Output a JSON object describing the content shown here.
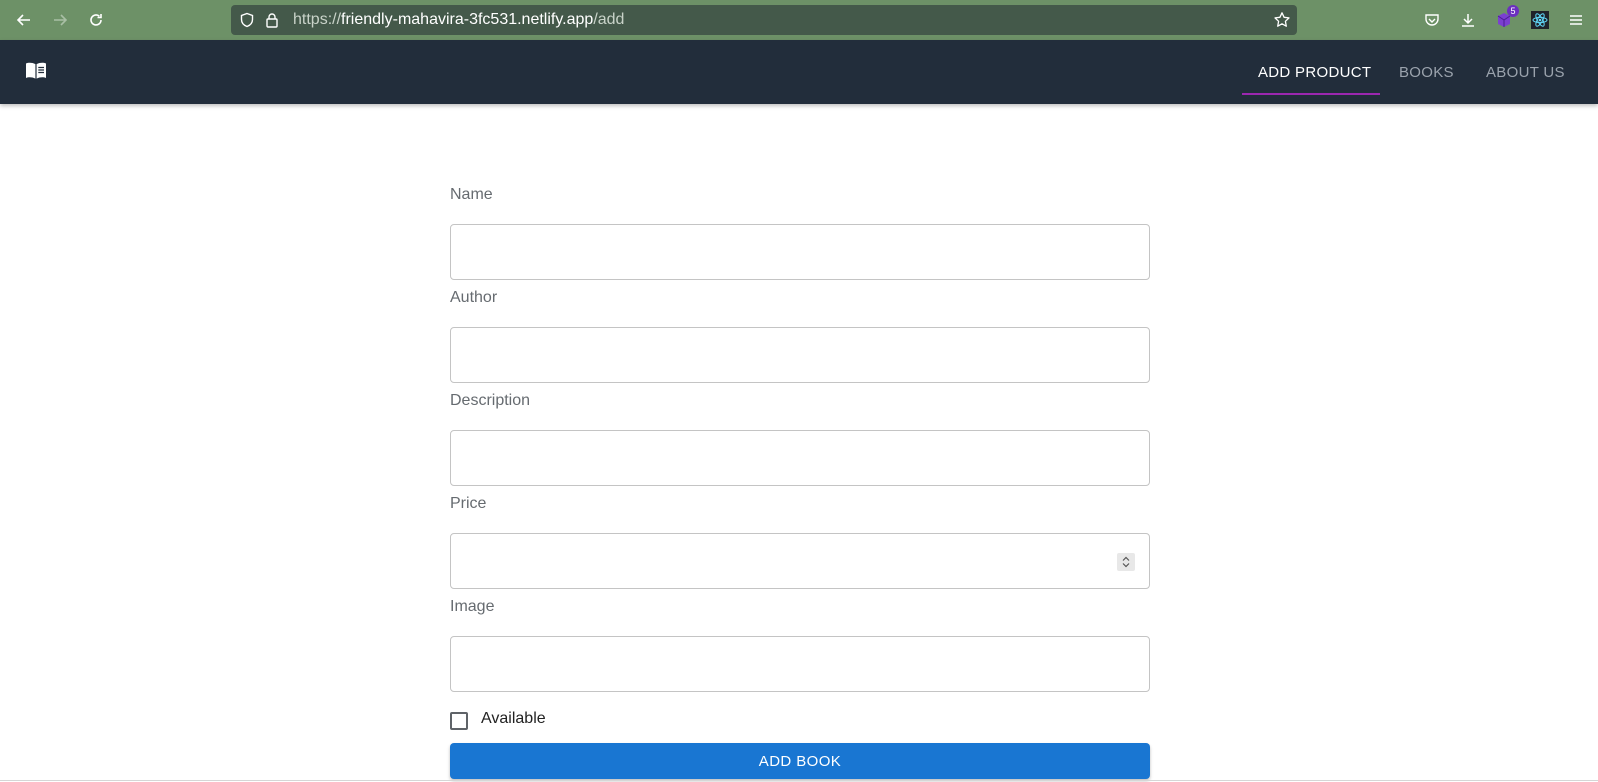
{
  "browser": {
    "url_prefix": "https://",
    "url_host": "friendly-mahavira-3fc531.netlify.app",
    "url_path": "/add",
    "extension_badge": "5"
  },
  "header": {
    "tabs": [
      {
        "label": "ADD PRODUCT",
        "active": true
      },
      {
        "label": "BOOKS",
        "active": false
      },
      {
        "label": "ABOUT US",
        "active": false
      }
    ],
    "accent_color": "#9c27b0",
    "background_color": "#222d3b"
  },
  "form": {
    "fields": [
      {
        "label": "Name",
        "value": ""
      },
      {
        "label": "Author",
        "value": ""
      },
      {
        "label": "Description",
        "value": ""
      },
      {
        "label": "Price",
        "value": ""
      },
      {
        "label": "Image",
        "value": ""
      }
    ],
    "checkbox_label": "Available",
    "checkbox_checked": false,
    "submit_label": "ADD BOOK",
    "submit_color": "#1976d2"
  }
}
